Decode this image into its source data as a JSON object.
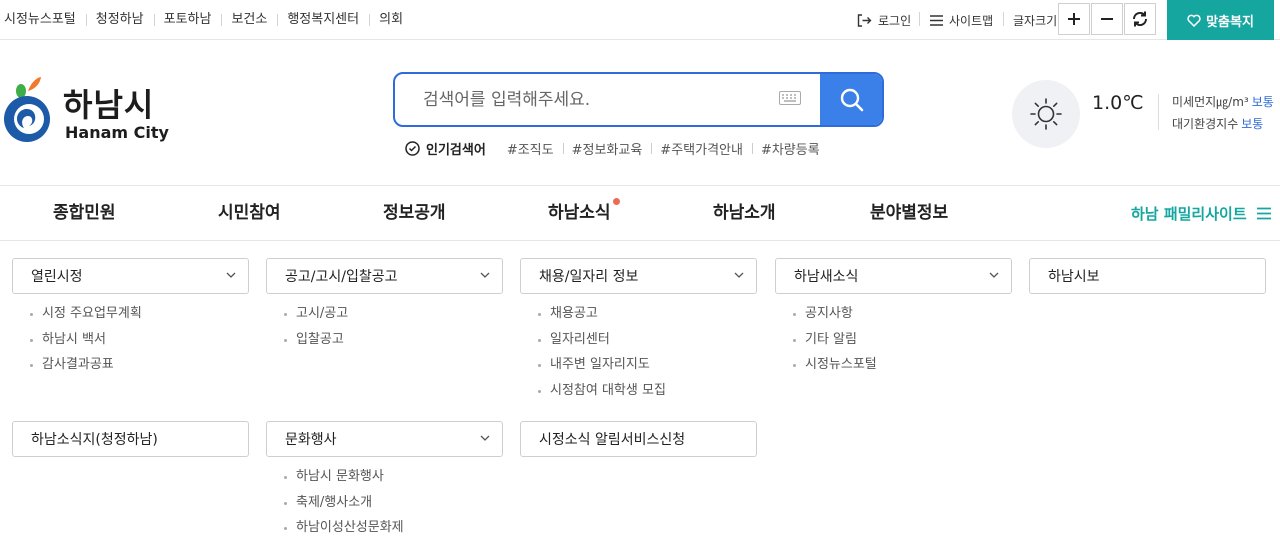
{
  "top_links": [
    "시정뉴스포털",
    "청정하남",
    "포토하남",
    "보건소",
    "행정복지센터",
    "의회"
  ],
  "utility": {
    "login": "로그인",
    "sitemap": "사이트맵",
    "font_size": "글자크기",
    "custom_welfare": "맞춤복지"
  },
  "logo": {
    "korean": "하남시",
    "english": "Hanam City"
  },
  "search": {
    "placeholder": "검색어를 입력해주세요.",
    "popular_title": "인기검색어",
    "keywords": [
      "#조직도",
      "#정보화교육",
      "#주택가격안내",
      "#차량등록"
    ]
  },
  "weather": {
    "temperature": "1.0℃",
    "fine_dust_label": "미세먼지㎍/m³",
    "fine_dust_level": "보통",
    "air_index_label": "대기환경지수",
    "air_index_level": "보통",
    "icon": "sun-icon"
  },
  "gnb": {
    "items": [
      "종합민원",
      "시민참여",
      "정보공개",
      "하남소식",
      "하남소개",
      "분야별정보"
    ],
    "family_site": "하남 패밀리사이트"
  },
  "menu": {
    "row1": [
      {
        "title": "열린시정",
        "has_dropdown": true,
        "links": [
          "시정 주요업무계획",
          "하남시 백서",
          "감사결과공표"
        ]
      },
      {
        "title": "공고/고시/입찰공고",
        "has_dropdown": true,
        "links": [
          "고시/공고",
          "입찰공고"
        ]
      },
      {
        "title": "채용/일자리 정보",
        "has_dropdown": true,
        "links": [
          "채용공고",
          "일자리센터",
          "내주변 일자리지도",
          "시정참여 대학생 모집"
        ]
      },
      {
        "title": "하남새소식",
        "has_dropdown": true,
        "links": [
          "공지사항",
          "기타 알림",
          "시정뉴스포털"
        ]
      },
      {
        "title": "하남시보",
        "has_dropdown": false,
        "links": []
      }
    ],
    "row2": [
      {
        "title": "하남소식지(청정하남)",
        "has_dropdown": false,
        "links": []
      },
      {
        "title": "문화행사",
        "has_dropdown": true,
        "links": [
          "하남시 문화행사",
          "축제/행사소개",
          "하남이성산성문화제"
        ]
      },
      {
        "title": "시정소식 알림서비스신청",
        "has_dropdown": false,
        "links": []
      }
    ]
  },
  "colors": {
    "accent_teal": "#16a6a0",
    "search_blue": "#3a80e8",
    "notice_dot": "#f06a52"
  }
}
